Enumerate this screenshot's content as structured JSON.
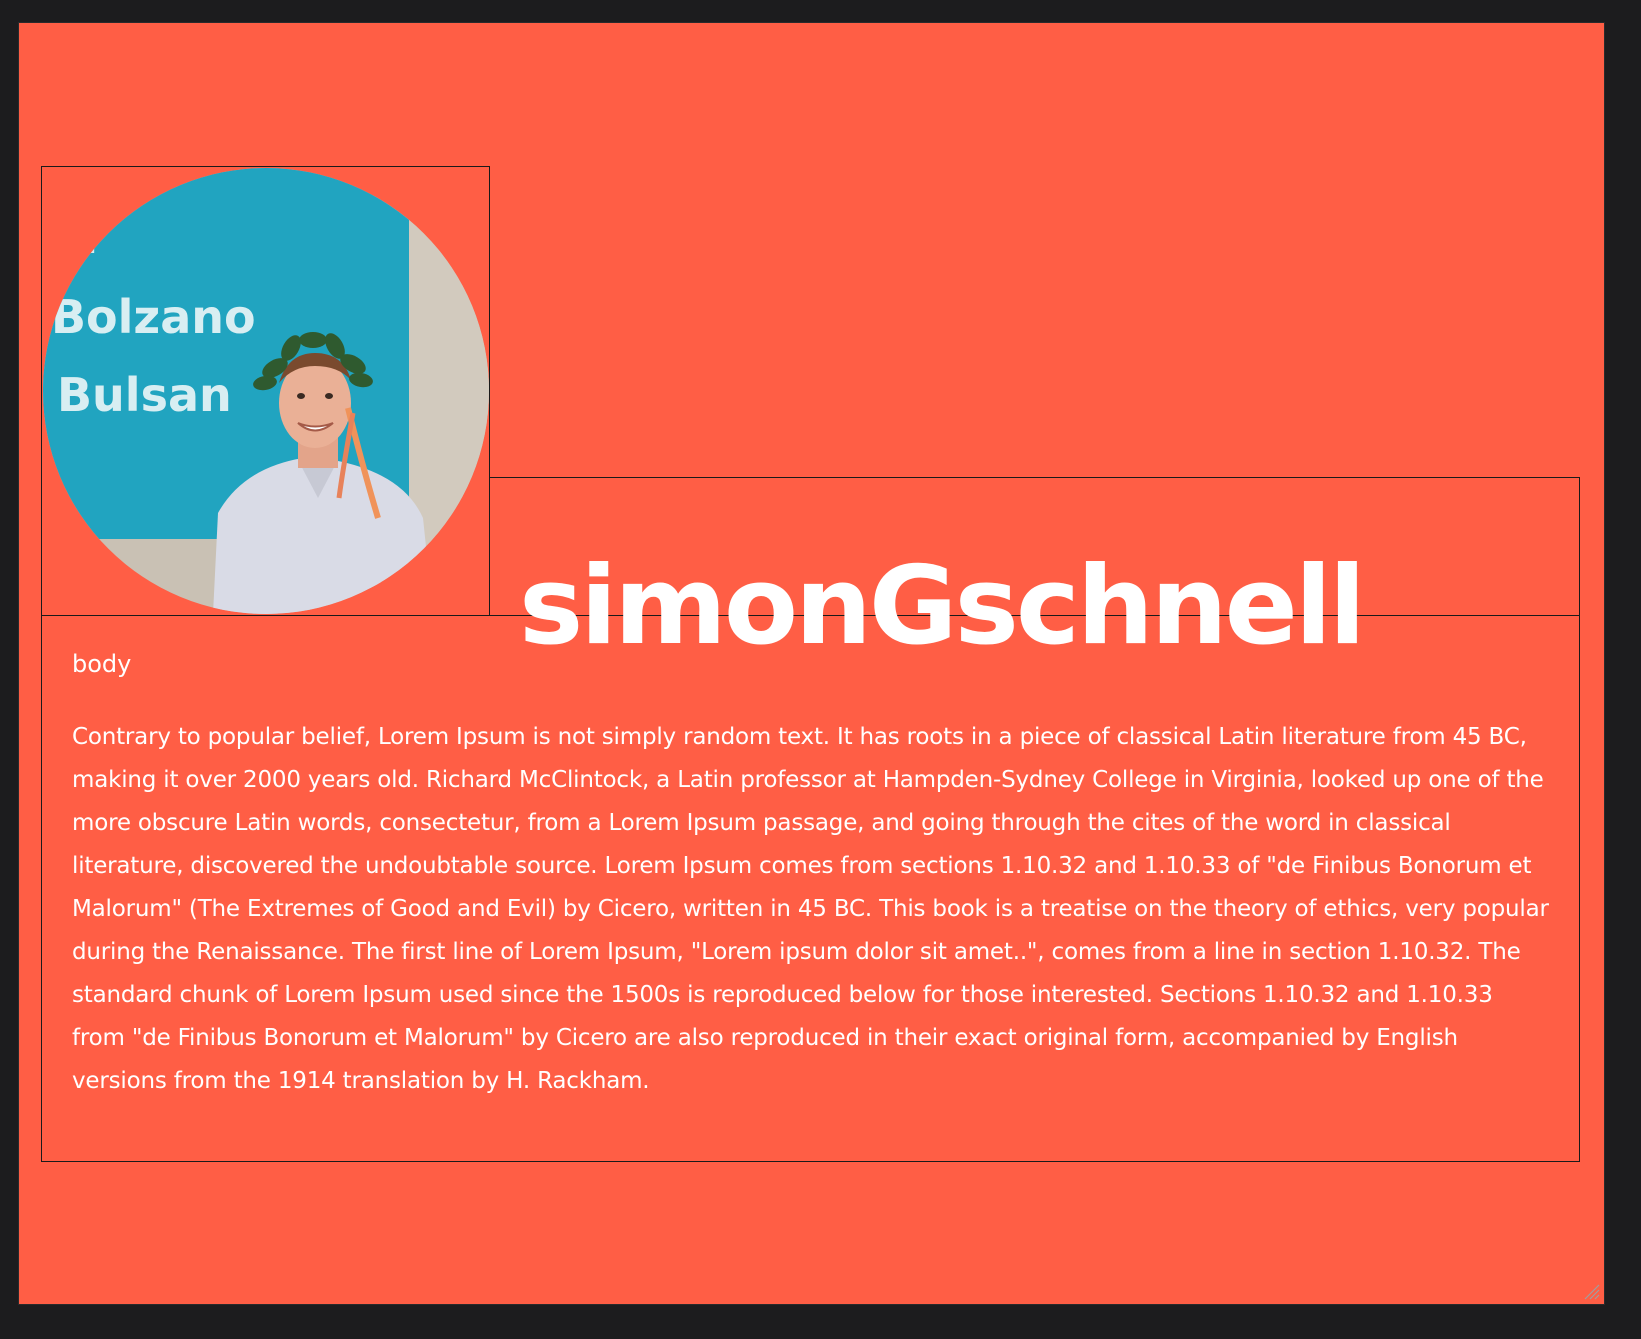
{
  "profile": {
    "avatar_alt": "Profile photo",
    "photo_sign_text": [
      "n",
      "Bolzano",
      "Bulsan"
    ],
    "name": "simonGschnell"
  },
  "content": {
    "section_label": "body",
    "paragraph": "Contrary to popular belief, Lorem Ipsum is not simply random text. It has roots in a piece of classical Latin literature from 45 BC, making it over 2000 years old. Richard McClintock, a Latin professor at Hampden-Sydney College in Virginia, looked up one of the more obscure Latin words, consectetur, from a Lorem Ipsum passage, and going through the cites of the word in classical literature, discovered the undoubtable source. Lorem Ipsum comes from sections 1.10.32 and 1.10.33 of \"de Finibus Bonorum et Malorum\" (The Extremes of Good and Evil) by Cicero, written in 45 BC. This book is a treatise on the theory of ethics, very popular during the Renaissance. The first line of Lorem Ipsum, \"Lorem ipsum dolor sit amet..\", comes from a line in section 1.10.32. The standard chunk of Lorem Ipsum used since the 1500s is reproduced below for those interested. Sections 1.10.32 and 1.10.33 from \"de Finibus Bonorum et Malorum\" by Cicero are also reproduced in their exact original form, accompanied by English versions from the 1914 translation by H. Rackham."
  },
  "colors": {
    "page_background": "#ff5e45",
    "window_chrome": "#1c1c1e",
    "text": "#ffffff",
    "border": "#1a1a1a",
    "sign_blue": "#21a4c0"
  }
}
